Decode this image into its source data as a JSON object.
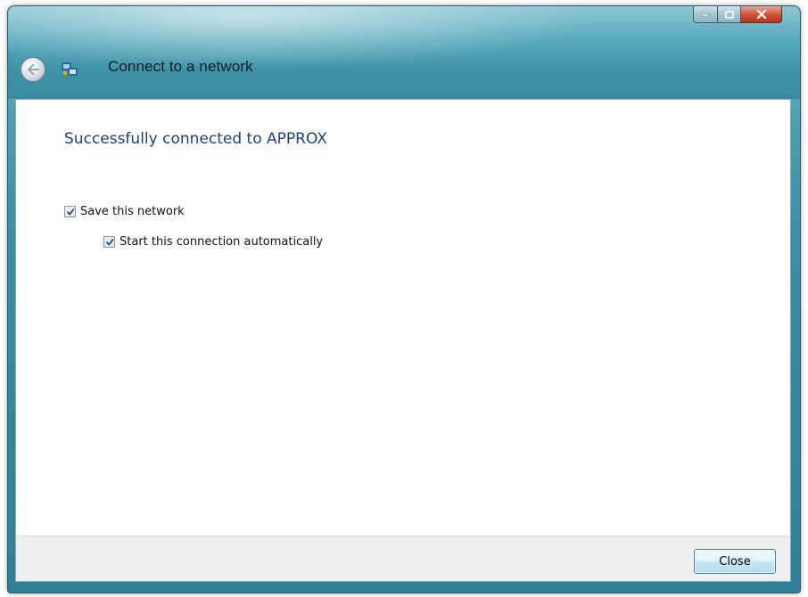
{
  "window": {
    "title": "Connect to a network",
    "buttons": {
      "minimize_icon": "minimize-icon",
      "maximize_icon": "maximize-icon",
      "close_icon": "close-icon"
    },
    "back_icon": "back-arrow-icon",
    "app_icon": "network-icon"
  },
  "main": {
    "headline_prefix": "Successfully connected to ",
    "network_name": "APPROX",
    "options": [
      {
        "label": "Save this network",
        "checked": true
      },
      {
        "label": "Start this connection automatically",
        "checked": true
      }
    ]
  },
  "footer": {
    "close_label": "Close"
  },
  "colors": {
    "accent_text": "#1e3f7a",
    "frame": "#3a8ca3"
  }
}
